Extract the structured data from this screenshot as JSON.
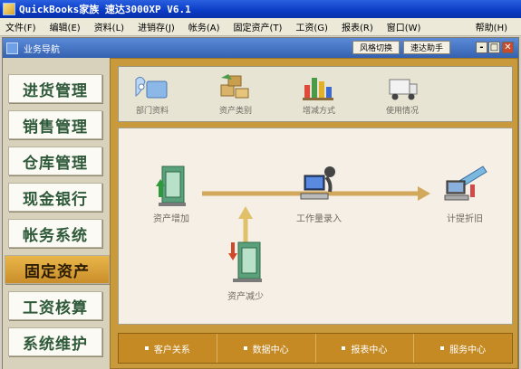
{
  "window": {
    "title": "QuickBooks家族 速达3000XP V6.1"
  },
  "menubar": {
    "items": [
      "文件(F)",
      "编辑(E)",
      "资料(L)",
      "进销存(J)",
      "帐务(A)",
      "固定资产(T)",
      "工资(G)",
      "报表(R)",
      "窗口(W)"
    ],
    "help": "帮助(H)"
  },
  "subwindow": {
    "title": "业务导航",
    "style_switch": "风格切换",
    "assistant": "速达助手",
    "minimize": "-",
    "restore": "□",
    "close": "✕"
  },
  "sidebar": {
    "items": [
      "进货管理",
      "销售管理",
      "仓库管理",
      "现金银行",
      "帐务系统",
      "固定资产",
      "工资核算",
      "系统维护"
    ],
    "active_index": 5
  },
  "toolbar": {
    "items": [
      {
        "label": "部门资料",
        "icon": "department-icon"
      },
      {
        "label": "资产类别",
        "icon": "asset-category-icon"
      },
      {
        "label": "增减方式",
        "icon": "change-method-icon"
      },
      {
        "label": "使用情况",
        "icon": "usage-status-icon"
      }
    ]
  },
  "flow": {
    "asset_add": "资产增加",
    "workload_entry": "工作量录入",
    "depreciation": "计提折旧",
    "asset_reduce": "资产减少"
  },
  "bottom": {
    "links": [
      "客户关系",
      "数据中心",
      "报表中心",
      "服务中心"
    ]
  },
  "colors": {
    "nav_text": "#2f5a3a",
    "active_nav": "#d9a33a",
    "main_frame": "#c99a3c",
    "flow_arrow": "#d2a85a"
  }
}
